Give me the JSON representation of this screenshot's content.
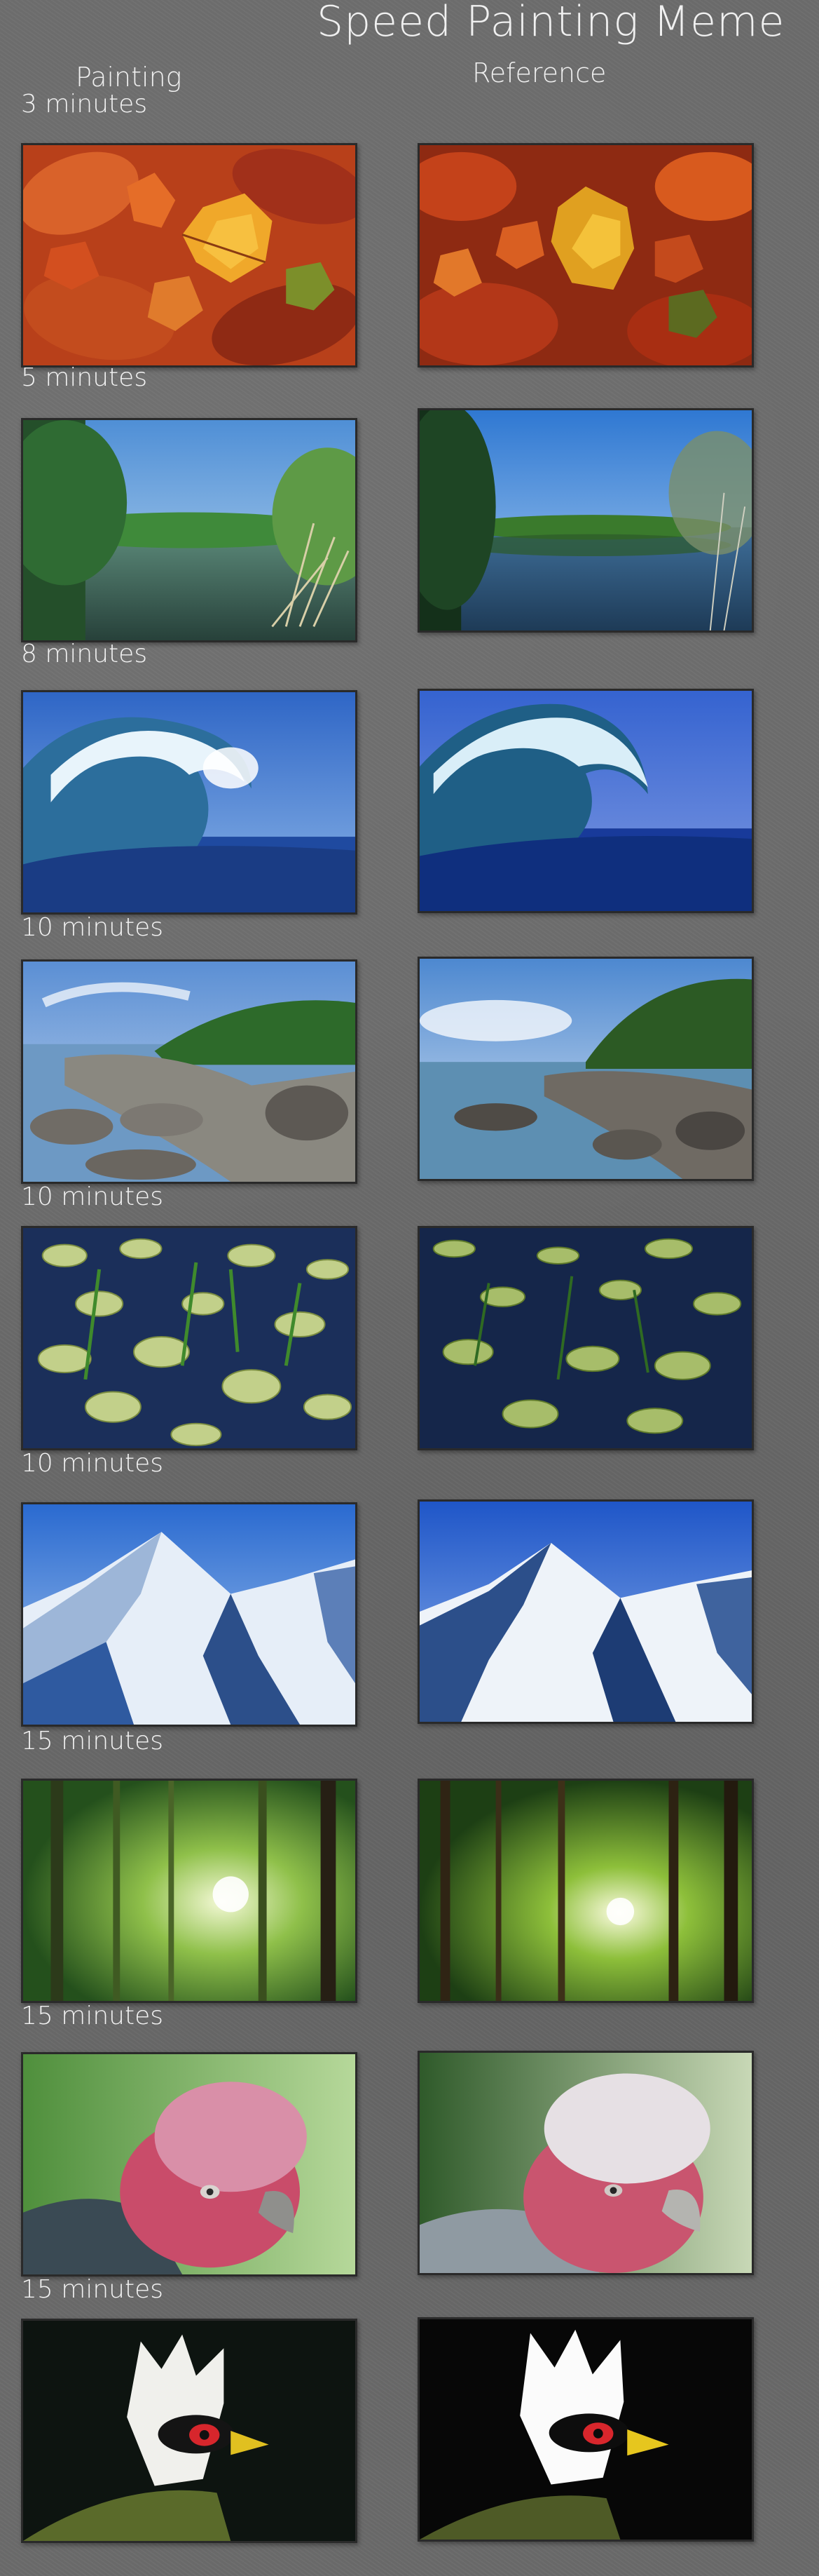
{
  "title": "Speed Painting Meme",
  "columns": {
    "painting": "Painting",
    "reference": "Reference"
  },
  "rows": [
    {
      "duration": "3 minutes",
      "subject": "autumn leaves"
    },
    {
      "duration": "5 minutes",
      "subject": "lake"
    },
    {
      "duration": "8 minutes",
      "subject": "wave"
    },
    {
      "duration": "10 minutes",
      "subject": "rocky coast"
    },
    {
      "duration": "10 minutes",
      "subject": "lily pads"
    },
    {
      "duration": "10 minutes",
      "subject": "snowy mountain"
    },
    {
      "duration": "15 minutes",
      "subject": "forest"
    },
    {
      "duration": "15 minutes",
      "subject": "galah"
    },
    {
      "duration": "15 minutes",
      "subject": "turaco"
    }
  ],
  "colors": {
    "background": "#6b6b6b",
    "text": "#f0f0f0",
    "frame_border": "#2a2a2a"
  }
}
